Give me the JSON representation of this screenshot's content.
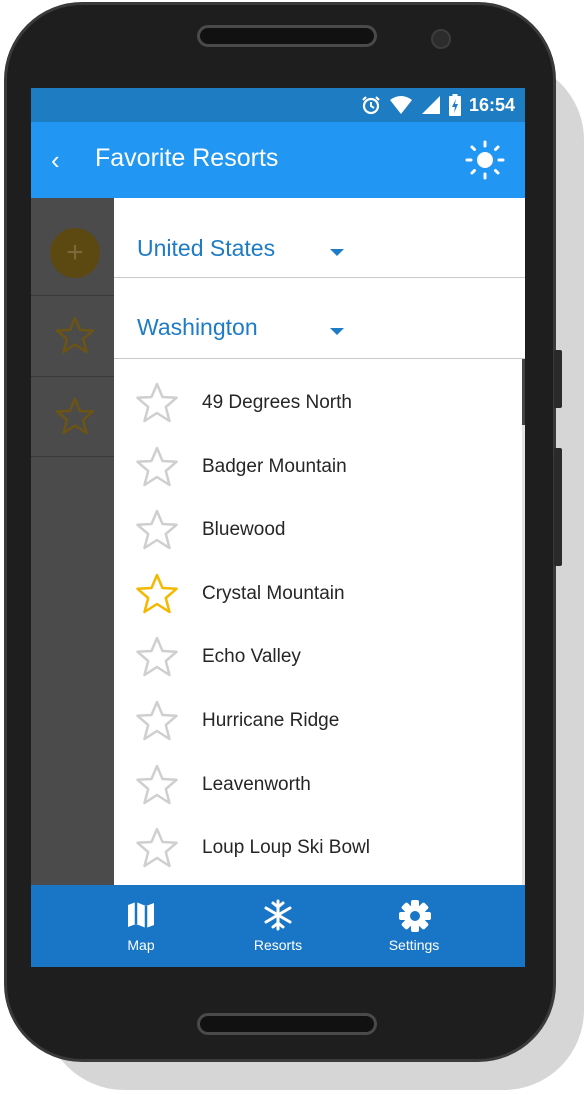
{
  "status_bar": {
    "time": "16:54"
  },
  "app_bar": {
    "title": "Favorite Resorts"
  },
  "filters": {
    "country": "United States",
    "state": "Washington"
  },
  "resorts": [
    {
      "name": "49 Degrees North",
      "favorite": false
    },
    {
      "name": "Badger Mountain",
      "favorite": false
    },
    {
      "name": "Bluewood",
      "favorite": false
    },
    {
      "name": "Crystal Mountain",
      "favorite": true
    },
    {
      "name": "Echo Valley",
      "favorite": false
    },
    {
      "name": "Hurricane Ridge",
      "favorite": false
    },
    {
      "name": "Leavenworth",
      "favorite": false
    },
    {
      "name": "Loup Loup Ski Bowl",
      "favorite": false
    }
  ],
  "bottom_nav": {
    "items": [
      {
        "label": "Map",
        "icon": "map-icon"
      },
      {
        "label": "Resorts",
        "icon": "snowflake-icon"
      },
      {
        "label": "Settings",
        "icon": "gear-icon"
      }
    ]
  },
  "colors": {
    "app_bar": "#2196f3",
    "status_bar": "#1d7cc2",
    "bottom_nav": "#1976c6",
    "accent_text": "#1e7bc6",
    "star_favorite": "#f5b800",
    "star_default": "#cfcfcf"
  }
}
